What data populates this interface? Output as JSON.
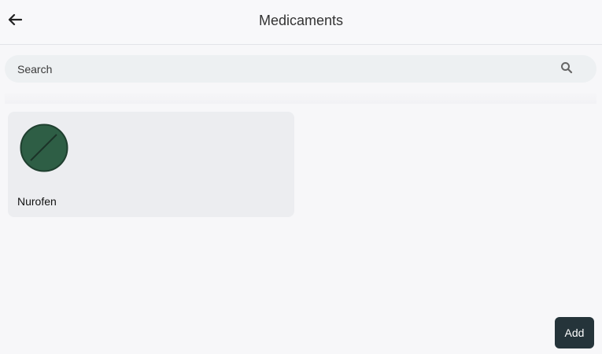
{
  "header": {
    "title": "Medicaments",
    "back_icon": "arrow-left-icon"
  },
  "search": {
    "placeholder": "Search",
    "value": "",
    "icon": "search-icon"
  },
  "medicaments": [
    {
      "name": "Nurofen",
      "icon": "pill-icon",
      "color": "#2e5e45"
    }
  ],
  "actions": {
    "add_label": "Add"
  },
  "colors": {
    "background": "#f7f7f9",
    "card": "#ecedf0",
    "search_bg": "#edf0f2",
    "add_button": "#25343a",
    "pill": "#2e5e45"
  }
}
